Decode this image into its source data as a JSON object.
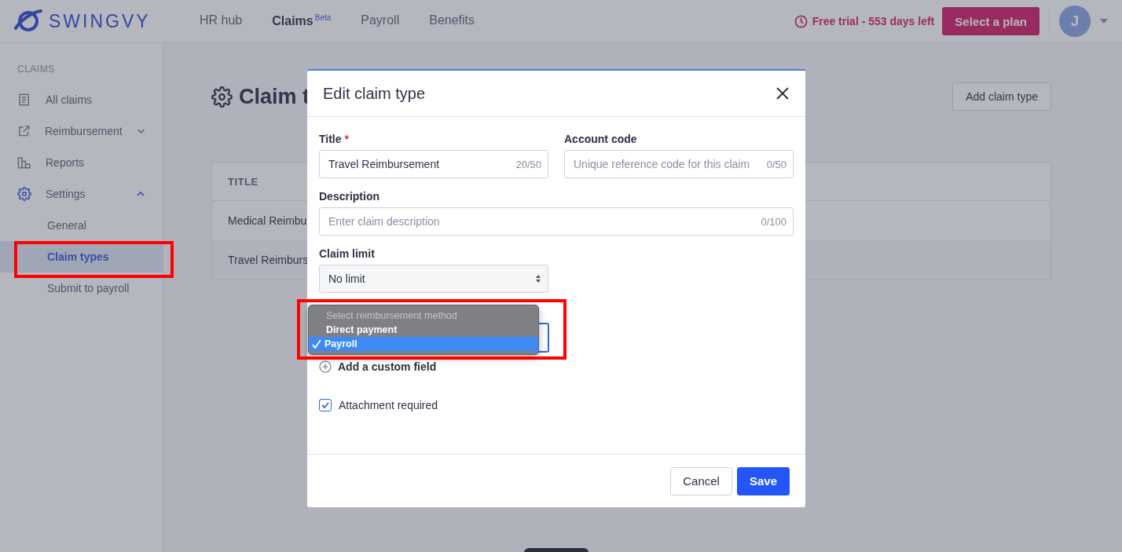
{
  "brand": {
    "name": "SWINGVY"
  },
  "nav": [
    {
      "label": "HR hub",
      "selected": false
    },
    {
      "label": "Claims",
      "selected": true,
      "badge": "Beta"
    },
    {
      "label": "Payroll",
      "selected": false
    },
    {
      "label": "Benefits",
      "selected": false
    }
  ],
  "trial": {
    "text": "Free trial - 553 days left"
  },
  "plan_button": "Select a plan",
  "avatar": {
    "initial": "J"
  },
  "sidebar": {
    "heading": "CLAIMS",
    "items": [
      {
        "label": "All claims",
        "kind": "document"
      },
      {
        "label": "Reimbursement",
        "kind": "external",
        "expanded": false
      },
      {
        "label": "Reports",
        "kind": "chart"
      },
      {
        "label": "Settings",
        "kind": "gear",
        "expanded": true,
        "children": [
          {
            "label": "General",
            "selected": false
          },
          {
            "label": "Claim types",
            "selected": true
          },
          {
            "label": "Submit to payroll",
            "selected": false
          }
        ]
      }
    ]
  },
  "page": {
    "title": "Claim t",
    "add_button": "Add claim type",
    "table": {
      "columns": [
        "TITLE"
      ],
      "rows": [
        [
          "Medical Reimbu"
        ],
        [
          "Travel Reimburs"
        ]
      ]
    }
  },
  "modal": {
    "title": "Edit claim type",
    "fields": [
      {
        "label": "Title",
        "kind": "text",
        "required_mark": "*",
        "value": "Travel Reimbursement",
        "counter": "20/50"
      },
      {
        "label": "Account code",
        "kind": "text",
        "placeholder": "Unique reference code for this claim",
        "counter": "0/50"
      },
      {
        "label": "Description",
        "kind": "long_text",
        "placeholder": "Enter claim description",
        "counter": "0/100"
      },
      {
        "label": "Claim limit",
        "kind": "select",
        "value": "No limit"
      }
    ],
    "dropdown": {
      "options": [
        {
          "label": "Select reimbursement method",
          "kind": "placeholder",
          "selected": false
        },
        {
          "label": "Direct payment",
          "kind": "option",
          "selected": false
        },
        {
          "label": "Payroll",
          "kind": "option",
          "selected": true
        }
      ]
    },
    "add_field": "Add a custom field",
    "attachment": {
      "label": "Attachment required",
      "checked": true
    },
    "buttons": [
      {
        "label": "Cancel",
        "kind": "secondary"
      },
      {
        "label": "Save",
        "kind": "primary"
      }
    ]
  }
}
